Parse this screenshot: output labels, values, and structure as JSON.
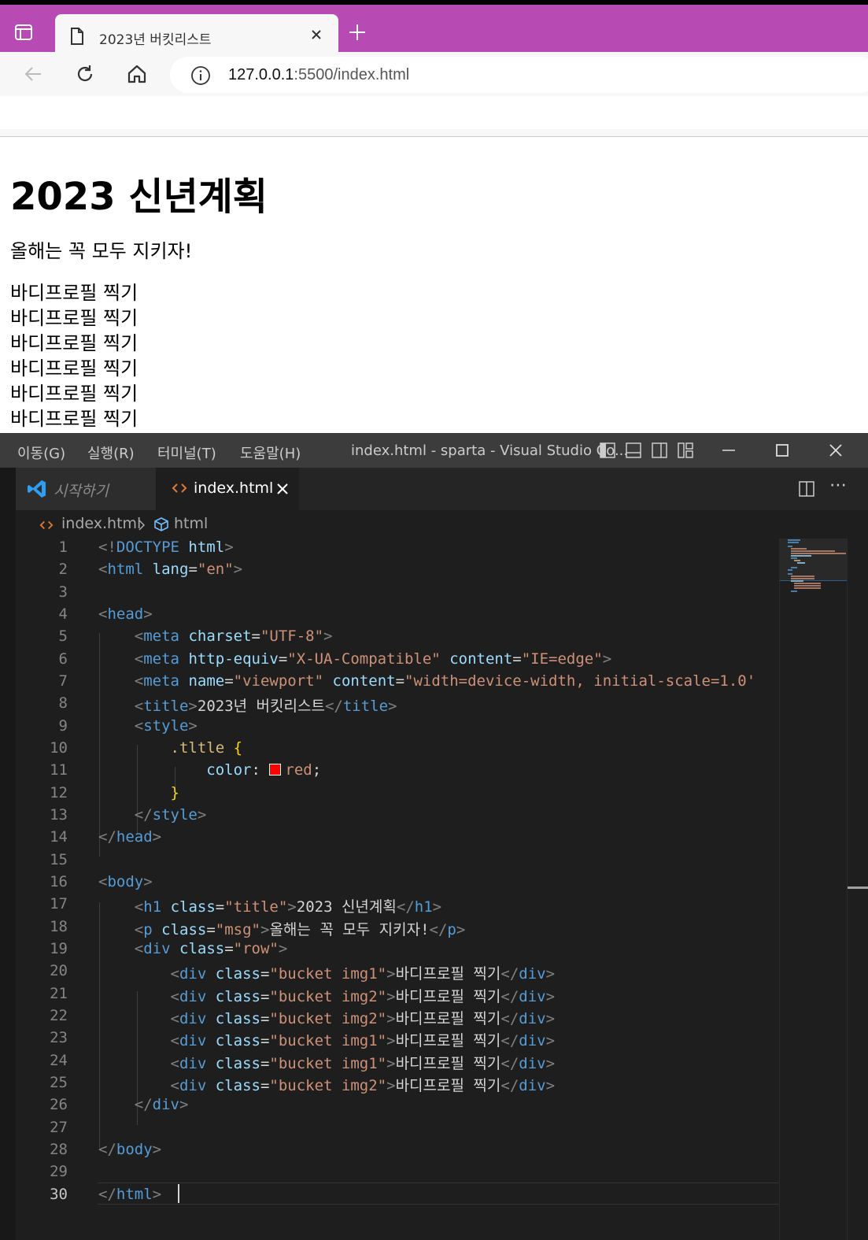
{
  "browser": {
    "tab_title": "2023년 버킷리스트",
    "url_host": "127.0.0.1",
    "url_rest": ":5500/index.html"
  },
  "page": {
    "heading": "2023 신년계획",
    "message": "올해는 꼭 모두 지키자!",
    "buckets": [
      "바디프로필 찍기",
      "바디프로필 찍기",
      "바디프로필 찍기",
      "바디프로필 찍기",
      "바디프로필 찍기",
      "바디프로필 찍기"
    ]
  },
  "vscode": {
    "menus": [
      "이동(G)",
      "실행(R)",
      "터미널(T)",
      "도움말(H)"
    ],
    "window_title": "index.html - sparta - Visual Studio Co...",
    "tabs": {
      "start": "시작하기",
      "index": "index.html"
    },
    "breadcrumb": {
      "file": "index.html",
      "symbol": "html"
    },
    "line_numbers": [
      "1",
      "2",
      "3",
      "4",
      "5",
      "6",
      "7",
      "8",
      "9",
      "10",
      "11",
      "12",
      "13",
      "14",
      "15",
      "16",
      "17",
      "18",
      "19",
      "20",
      "21",
      "22",
      "23",
      "24",
      "25",
      "26",
      "27",
      "28",
      "29",
      "30"
    ],
    "code": {
      "l8_title_text": "2023년 버킷리스트",
      "l17_text": "2023 신년계획",
      "l18_text": "올해는 꼭 모두 지키자!",
      "bucket_text": "바디프로필 찍기",
      "swatch_color": "#ff0000"
    }
  }
}
